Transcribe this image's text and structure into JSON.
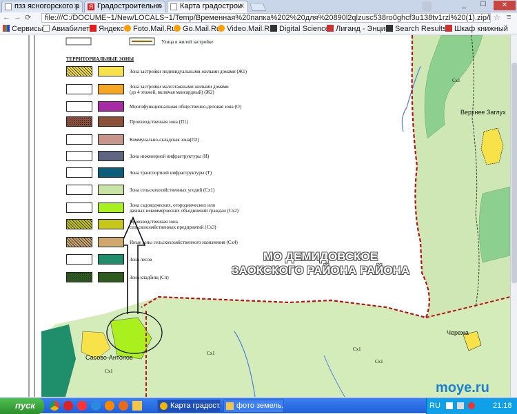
{
  "tabs": [
    {
      "label": "пзз ясногорского р",
      "icon": "document-icon",
      "active": false
    },
    {
      "label": "Градостроительно",
      "icon": "yandex-icon",
      "active": false
    },
    {
      "label": "Карта градострои",
      "icon": "document-icon",
      "active": true
    }
  ],
  "address": {
    "url": "file:///C:/DOCUME~1/New/LOCALS~1/Temp/Временная%20папка%202%20для%20890l2qlzusc538ro0ghcf3u138tv1rzl%20(1).zip/Карта%20градос"
  },
  "bookmarks": [
    "Сервисы",
    "Авиабилеты",
    "Яндекс",
    "Foto.Mail.Ru",
    "Go.Mail.Ru",
    "Video.Mail.Ru",
    "Digital Science",
    "Лиганд - Энцик",
    "Search Results -",
    "Шкаф книжный"
  ],
  "legend": {
    "road_label": "Улица в жилой застройке",
    "header": "ТЕРРИТОРИАЛЬНЫЕ ЗОНЫ",
    "items": [
      {
        "label": "Зона застройки индивидуальными жилыми домами (Ж1)",
        "color": "#f7e24a",
        "pattern": "hatch"
      },
      {
        "label": "Зона застройки малоэтажными жилыми домами",
        "label2": "(до 4 этажей, включая мансардный) (Ж2)",
        "color": "#f5a623",
        "pattern": "none"
      },
      {
        "label": "Многофункциональная общественно-деловая зона (О)",
        "color": "#a72ba5",
        "pattern": "none"
      },
      {
        "label": "Производственная зона (П1)",
        "color": "#8a5038",
        "pattern": "dots"
      },
      {
        "label": "Коммунально-складская зона(П2)",
        "color": "#c9948a",
        "pattern": "none"
      },
      {
        "label": "Зона инженерной инфраструктуры (И)",
        "color": "#5d6580",
        "pattern": "none"
      },
      {
        "label": "Зона транспортной инфраструктуры (Т)",
        "color": "#0b5d79",
        "pattern": "none"
      },
      {
        "label": "Зона сельскохозяйственных угодий (Сх1)",
        "color": "#c8e3a3",
        "pattern": "none"
      },
      {
        "label": "Зона садоводческих, огороднических или",
        "label2": "дачных некоммерческих объединений граждан (Сх2)",
        "color": "#a9f01e",
        "pattern": "none"
      },
      {
        "label": "Производственная зона",
        "label2": "сельскохозяйственных предприятий (Сх3)",
        "color": "#c5c81a",
        "pattern": "hatch"
      },
      {
        "label": "Иные зоны сельскохозяйственного назначения (Сх4)",
        "color": "#cfa870",
        "pattern": "hatch"
      },
      {
        "label": "Зона лесов",
        "color": "#1f8f6b",
        "pattern": "none"
      },
      {
        "label": "Зона кладбищ (Сп)",
        "color": "#2e5b1d",
        "pattern": "dots"
      }
    ]
  },
  "map": {
    "region_title_1": "МО ДЕМИДОВСКОЕ",
    "region_title_2": "ЗАОКСКОГО РАЙОНА РАЙОНА",
    "village_1": "Верхнее Заглух",
    "village_2": "Чережа",
    "village_3": "Сасово-Антонов",
    "zone_code": "Сх1"
  },
  "taskbar": {
    "start": "пуск",
    "buttons": [
      "Карта градост...",
      "фото земель..."
    ],
    "lang": "RU",
    "time": "21:18",
    "watermark": "moye.ru"
  }
}
